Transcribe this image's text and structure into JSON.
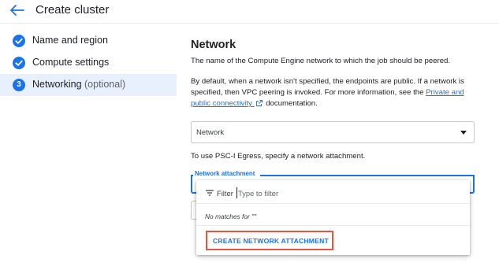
{
  "header": {
    "title": "Create cluster",
    "back_icon": "arrow-back-icon"
  },
  "sidebar": {
    "items": [
      {
        "label": "Name and region",
        "status": "complete"
      },
      {
        "label": "Compute settings",
        "status": "complete"
      },
      {
        "label": "Networking",
        "suffix": "(optional)",
        "number": "3",
        "status": "active"
      }
    ]
  },
  "network": {
    "heading": "Network",
    "description": "The name of the Compute Engine network to which the job should be peered.",
    "default_text_1": "By default, when a network isn't specified, the endpoints are public. If a network is specified, then VPC peering is invoked. For more information, see the ",
    "link_text": "Private and public connectivity",
    "default_text_2": " documentation.",
    "select_value": "Network"
  },
  "psc": {
    "text": "To use PSC-I Egress, specify a network attachment.",
    "field_label": "Network attachment"
  },
  "dropdown": {
    "filter_label": "Filter",
    "filter_placeholder": "Type to filter",
    "no_matches": "No matches for \"\"",
    "create_button": "CREATE NETWORK ATTACHMENT"
  },
  "colors": {
    "accent": "#1a73e8",
    "highlight_outline": "#e8553e",
    "active_step_bg": "#e8f0fe"
  }
}
